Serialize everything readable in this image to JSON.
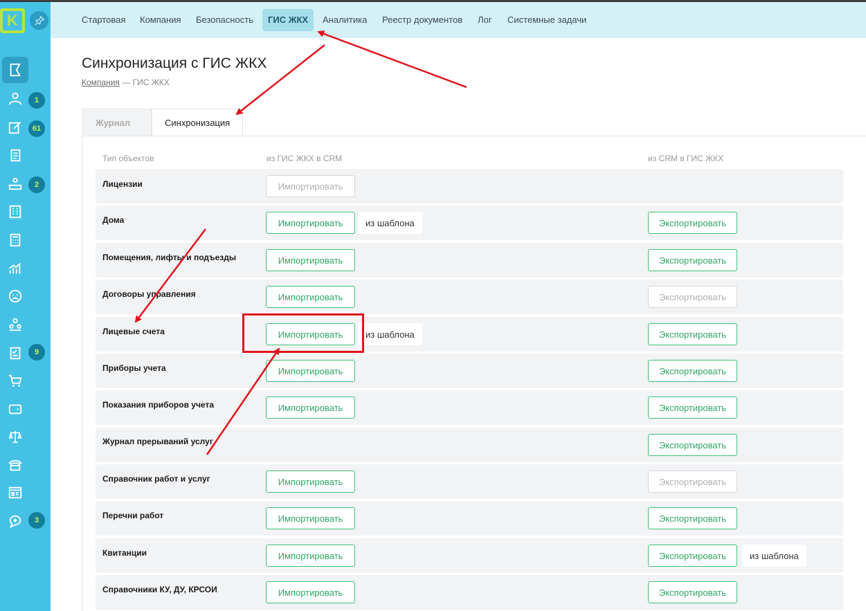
{
  "colors": {
    "sidebar": "#45c1e6",
    "topnav": "#d4f1f8",
    "accent_green": "#3fbf78",
    "badge": "#137f9d",
    "annotation_red": "#e0141c"
  },
  "logo": {
    "letter": "K"
  },
  "sidebar": {
    "items": [
      {
        "icon": "flag-icon",
        "badge": ""
      },
      {
        "icon": "users-icon",
        "badge": "1"
      },
      {
        "icon": "edit-icon",
        "badge": "61"
      },
      {
        "icon": "documents-icon",
        "badge": ""
      },
      {
        "icon": "reception-icon",
        "badge": "2"
      },
      {
        "icon": "building-icon",
        "badge": ""
      },
      {
        "icon": "calculator-icon",
        "badge": ""
      },
      {
        "icon": "analytics-icon",
        "badge": ""
      },
      {
        "icon": "sad-face-icon",
        "badge": ""
      },
      {
        "icon": "team-icon",
        "badge": ""
      },
      {
        "icon": "checklist-icon",
        "badge": "9"
      },
      {
        "icon": "cart-icon",
        "badge": ""
      },
      {
        "icon": "wallet-icon",
        "badge": ""
      },
      {
        "icon": "scales-icon",
        "badge": ""
      },
      {
        "icon": "phone-icon",
        "badge": ""
      },
      {
        "icon": "dashboard-icon",
        "badge": ""
      },
      {
        "icon": "chat-add-icon",
        "badge": "3"
      }
    ]
  },
  "topnav": {
    "items": [
      "Стартовая",
      "Компания",
      "Безопасность",
      "ГИС ЖКХ",
      "Аналитика",
      "Реестр документов",
      "Лог",
      "Системные задачи"
    ],
    "active": "ГИС ЖКХ"
  },
  "page": {
    "title": "Синхронизация с ГИС ЖКХ",
    "breadcrumb_link": "Компания",
    "breadcrumb_sep": " — ",
    "breadcrumb_current": "ГИС ЖКХ"
  },
  "tabs": {
    "journal": "Журнал",
    "journal_icon": "↻",
    "sync": "Синхронизация"
  },
  "table": {
    "headers": {
      "type": "Тип объектов",
      "import": "из ГИС ЖКХ в CRM",
      "export": "из CRM в ГИС ЖКХ"
    },
    "import_label": "Импортировать",
    "export_label": "Экспортировать",
    "template_label": "из шаблона",
    "rows": [
      {
        "label": "Лицензии"
      },
      {
        "label": "Дома"
      },
      {
        "label": "Помещения, лифты и подъезды"
      },
      {
        "label": "Договоры управления"
      },
      {
        "label": "Лицевые счета"
      },
      {
        "label": "Приборы учета"
      },
      {
        "label": "Показания приборов учета"
      },
      {
        "label": "Журнал прерываний услуг"
      },
      {
        "label": "Справочник работ и услуг"
      },
      {
        "label": "Перечни работ"
      },
      {
        "label": "Квитанции"
      },
      {
        "label": "Справочники КУ, ДУ, КРСОИ"
      }
    ]
  }
}
